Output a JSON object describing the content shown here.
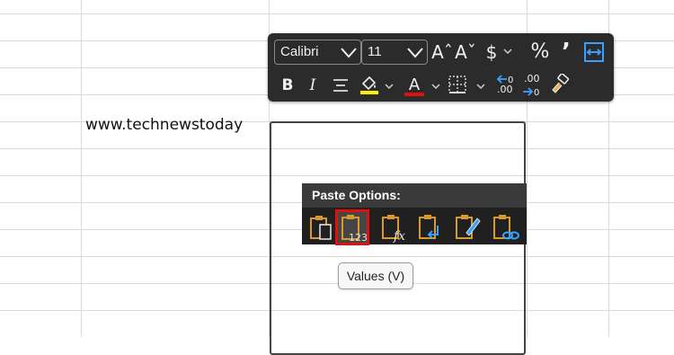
{
  "sheet": {
    "cell_text": "www.technewstoday",
    "gridline_color": "#dadada"
  },
  "mini_toolbar": {
    "font_name": "Calibri",
    "font_size": "11",
    "increase_font_icon": "Aˆ",
    "decrease_font_icon": "Aˇ",
    "currency_label": "$",
    "percent_label": "%",
    "comma_label": "’",
    "bold_label": "B",
    "italic_label": "I",
    "font_color_label": "A",
    "decimal_increase_label": ".00",
    "decimal_decrease_label": ".00",
    "fill_color": "#ffee00",
    "font_color": "#e01010"
  },
  "paste_options": {
    "header": "Paste Options:",
    "buttons": [
      {
        "icon": "paste-icon"
      },
      {
        "icon": "paste-values-icon",
        "badge": "123",
        "selected": true
      },
      {
        "icon": "paste-formulas-icon",
        "badge": "fx"
      },
      {
        "icon": "paste-transpose-icon"
      },
      {
        "icon": "paste-formatting-icon"
      },
      {
        "icon": "paste-link-icon"
      }
    ],
    "selected_color": "#e01010"
  },
  "tooltip": {
    "text": "Values (V)"
  }
}
